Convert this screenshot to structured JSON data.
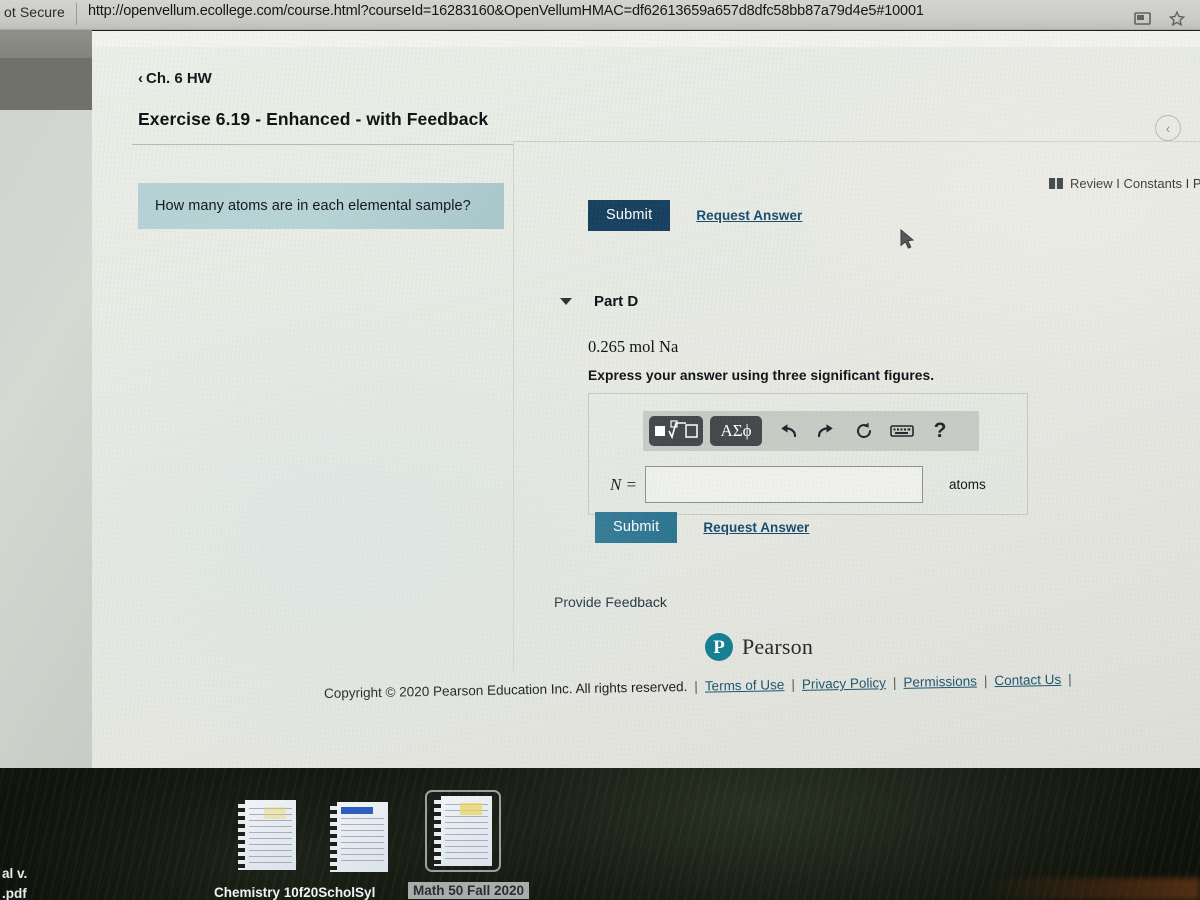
{
  "browser": {
    "security_label": "ot Secure",
    "url": "http://openvellum.ecollege.com/course.html?courseId=16283160&OpenVellumHMAC=df62613659a657d8dfc58bb87a79d4e5#10001",
    "cast_icon": "cast-icon",
    "bookmark_icon": "star-icon"
  },
  "assignment": {
    "back_chevron": "‹",
    "breadcrumb": "Ch. 6 HW",
    "title": "Exercise 6.19 - Enhanced - with Feedback",
    "resources_label": "Review I Constants I P",
    "book_icon": "book-icon",
    "collapse_icon": "‹"
  },
  "question": {
    "prompt": "How many atoms are in each elemental sample?",
    "prompt_bg": "#b6d2d6"
  },
  "top_actions": {
    "submit_label": "Submit",
    "submit_color": "#17405e",
    "request_answer_label": "Request Answer"
  },
  "part": {
    "caret_icon": "chevron-down-icon",
    "label": "Part D",
    "quantity": "0.265 mol Na",
    "instruction": "Express your answer using three significant figures."
  },
  "answer_widget": {
    "toolbar": [
      {
        "name": "math-template-button",
        "glyph": "■√□",
        "style": "dark"
      },
      {
        "name": "greek-symbols-button",
        "glyph": "ΑΣϕ",
        "style": "dark"
      },
      {
        "name": "undo-icon",
        "glyph": "↶",
        "style": "plain"
      },
      {
        "name": "redo-icon",
        "glyph": "↷",
        "style": "plain"
      },
      {
        "name": "reset-icon",
        "glyph": "↺",
        "style": "plain"
      },
      {
        "name": "keyboard-icon",
        "glyph": "⌨",
        "style": "plain"
      },
      {
        "name": "help-icon",
        "glyph": "?",
        "style": "plain"
      }
    ],
    "variable_label": "N =",
    "input_value": "",
    "input_placeholder": "",
    "unit_label": "atoms"
  },
  "bottom_actions": {
    "submit_label": "Submit",
    "submit_color": "#2b7390",
    "request_answer_label": "Request Answer"
  },
  "feedback": {
    "provide_feedback_label": "Provide Feedback"
  },
  "brand": {
    "mark_letter": "P",
    "name": "Pearson",
    "mark_color": "#147e92"
  },
  "footer": {
    "copyright": "Copyright © 2020 Pearson Education Inc. All rights reserved.",
    "separator": "|",
    "links": [
      "Terms of Use",
      "Privacy Policy",
      "Permissions",
      "Contact Us"
    ]
  },
  "dock": {
    "corner_text_line1": "al v.",
    "corner_text_line2": ".pdf",
    "items": [
      {
        "label": "Chemistry 10f20ScholSyl",
        "selected": false,
        "accent": "none"
      },
      {
        "label": "",
        "selected": false,
        "accent": "blue"
      },
      {
        "label": "Math 50 Fall 2020",
        "selected": true,
        "accent": "yellow"
      }
    ]
  }
}
